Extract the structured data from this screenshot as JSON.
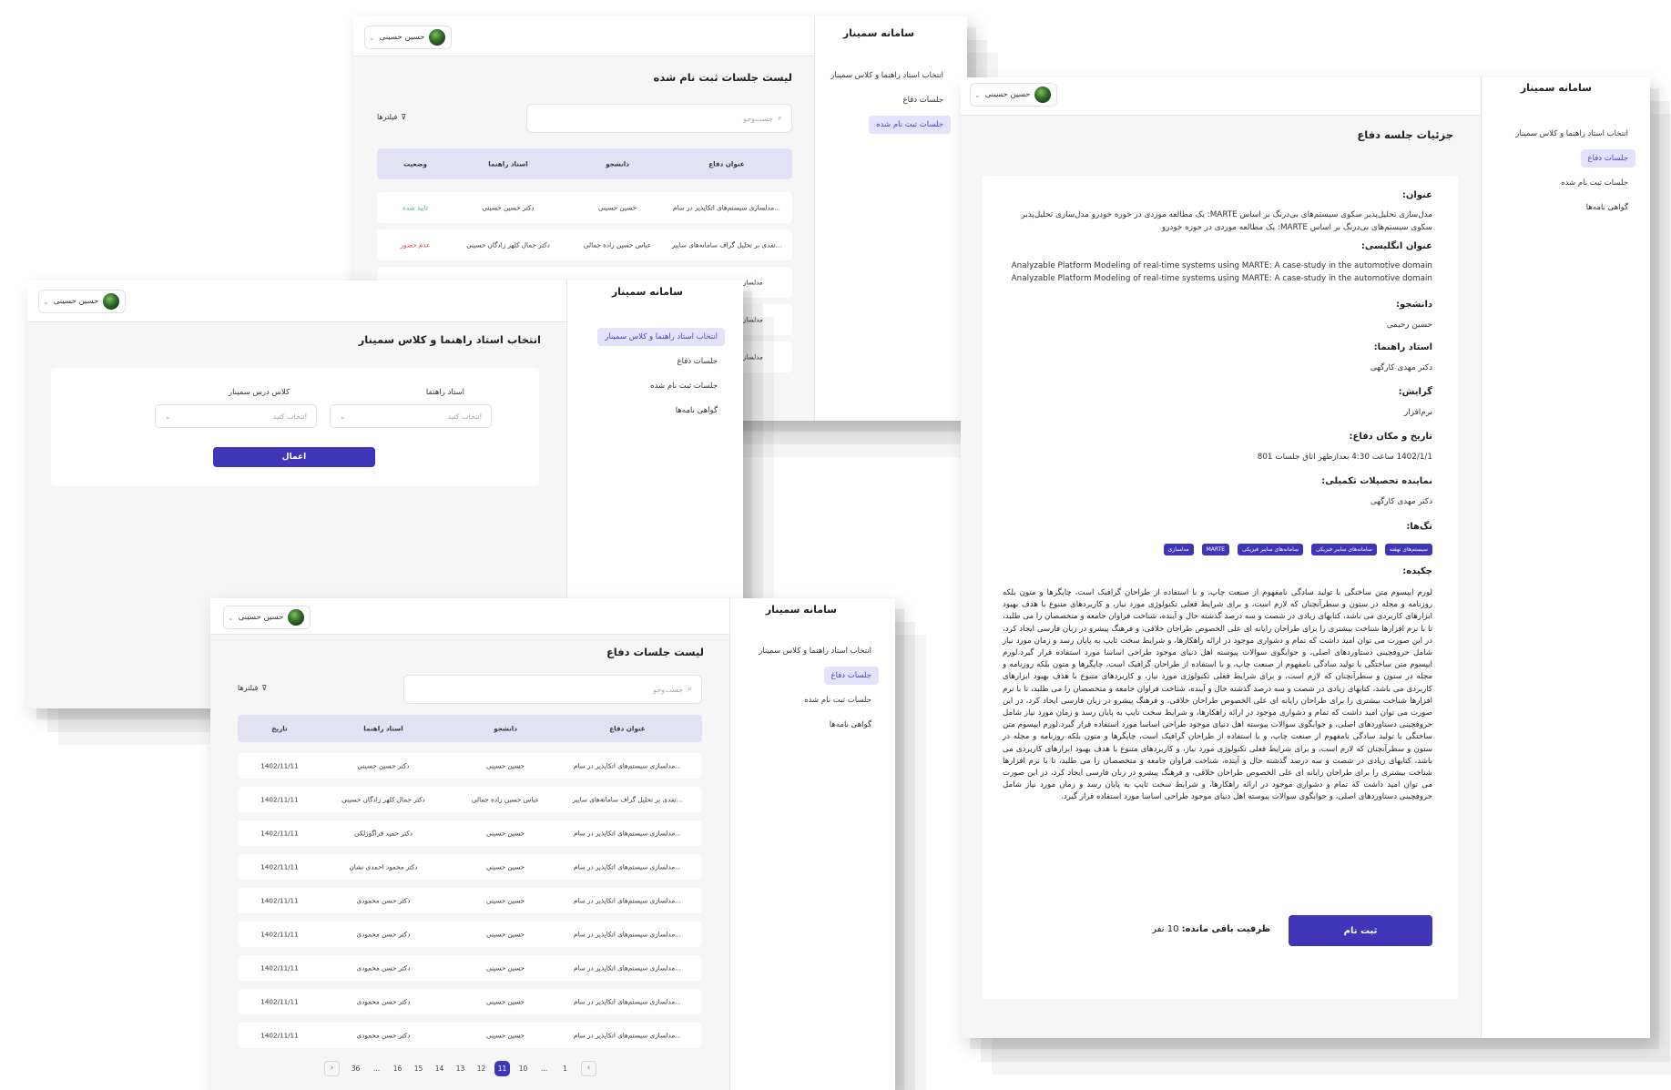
{
  "common": {
    "brand": "سامانه سمینار",
    "user_name": "حسین حسینی",
    "search_placeholder": "جست‌وجو",
    "filters_label": "فیلترها",
    "select_placeholder": "انتخاب کنید"
  },
  "nav": {
    "choose": "انتخاب استاد راهنما و کلاس سمینار",
    "defense": "جلسات دفاع",
    "registered": "جلسات ثبت نام شده",
    "certs": "گواهی نامه‌ها"
  },
  "registered_win": {
    "title": "لیست جلسات ثبت نام شده",
    "headers": [
      "عنوان دفاع",
      "دانشجو",
      "استاد راهنما",
      "وضعیت"
    ],
    "rows": [
      [
        "مدلسازی سیستم‌های اتکاپذیر در سام...",
        "حسین حسینی",
        "دکتر حسین حسینی",
        "تایید شده"
      ],
      [
        "نقدی بر تحلیل گراف سامانه‌های سایبر...",
        "عباس حسین زاده جمالی",
        "دکتر جمال کلهر زادگان حسینی",
        "عدم حضور"
      ],
      [
        "مدلسازی",
        "",
        "",
        ""
      ],
      [
        "مدلسازی",
        "",
        "",
        ""
      ],
      [
        "مدلسازی",
        "",
        "",
        ""
      ]
    ]
  },
  "choose_win": {
    "title": "انتخاب استاد راهنما و کلاس سمینار",
    "advisor_label": "استاد راهنما",
    "class_label": "کلاس درس سمینار",
    "apply": "اعمال"
  },
  "defense_win": {
    "title": "لیست جلسات دفاع",
    "headers": [
      "عنوان دفاع",
      "دانشجو",
      "استاد راهنما",
      "تاریخ"
    ],
    "rows": [
      [
        "مدلسازی سیستم‌های اتکاپذیر در سام...",
        "حسین حسینی",
        "دکتر حسین حسینی",
        "1402/11/11"
      ],
      [
        "نقدی بر تحلیل گراف سامانه‌های سایبر...",
        "عباس حسین زاده جمالی",
        "دکتر جمال کلهر زادگان حسینی",
        "1402/11/11"
      ],
      [
        "مدلسازی سیستم‌های اتکاپذیر در سام...",
        "حسین حسینی",
        "دکتر حمید قراگوزلکی",
        "1402/11/11"
      ],
      [
        "مدلسازی سیستم‌های اتکاپذیر در سام...",
        "حسین حسینی",
        "دکتر محمود احمدی نشان",
        "1402/11/11"
      ],
      [
        "مدلسازی سیستم‌های اتکاپذیر در سام...",
        "حسین حسینی",
        "دکتر حسن محمودی",
        "1402/11/11"
      ],
      [
        "مدلسازی سیستم‌های اتکاپذیر در سام...",
        "حسین حسینی",
        "دکتر حسن محمودی",
        "1402/11/11"
      ],
      [
        "مدلسازی سیستم‌های اتکاپذیر در سام...",
        "حسین حسینی",
        "دکتر حسن محمودی",
        "1402/11/11"
      ],
      [
        "مدلسازی سیستم‌های اتکاپذیر در سام...",
        "حسین حسینی",
        "دکتر حسن محمودی",
        "1402/11/11"
      ],
      [
        "مدلسازی سیستم‌های اتکاپذیر در سام...",
        "حسین حسینی",
        "دکتر حسن محمودی",
        "1402/11/11"
      ]
    ],
    "pager": {
      "prev": "›",
      "next": "‹",
      "pages": [
        "1",
        "...",
        "10",
        "11",
        "12",
        "13",
        "14",
        "15",
        "16",
        "...",
        "36"
      ],
      "current": "11"
    }
  },
  "detail_win": {
    "title": "جزئیات جلسه دفاع",
    "title_label": "عنوان:",
    "title_value": "مدل‌سازی تحلیل‌پذیر سکوی سیستم‌های بی‌درنگ بر اساس MARTE: یک مطالعه موردی در حوزه خودرو مدل‌سازی تحلیل‌پذیر سکوی سیستم‌های بی‌درنگ بر اساس MARTE: یک مطالعه موردی در حوزه خودرو",
    "en_label": "عنوان انگلیسی:",
    "en_value_1": "Analyzable Platform Modeling of real-time systems using MARTE: A case-study in the automotive domain",
    "en_value_2": "Analyzable Platform Modeling of real-time systems using MARTE: A case-study in the automotive domain",
    "student_label": "دانشجو:",
    "student_value": "حسین رحیمی",
    "advisor_label": "استاد راهنما:",
    "advisor_value": "دکتر مهدی کارگهی",
    "field_label": "گرایش:",
    "field_value": "نرم‌افزار",
    "datetime_label": "تاریخ و مکان دفاع:",
    "datetime_value": "1402/1/1 ساعت 4:30 بعدازظهر اتاق جلسات 801",
    "rep_label": "نماینده تحصیلات تکمیلی:",
    "rep_value": "دکتر مهدی کارگهی",
    "tags_label": "تگ‌ها:",
    "tags": [
      "سیستم‌های نهفته",
      "سامانه‌های سایبر فیزیکی",
      "سامانه‌های سایبر فیزیکی",
      "MARTE",
      "مدلسازی"
    ],
    "abstract_label": "چکیده:",
    "abstract": "لورم ایپسوم متن ساختگی با تولید سادگی نامفهوم از صنعت چاپ، و با استفاده از طراحان گرافیک است، چاپگرها و متون بلکه روزنامه و مجله در ستون و سطرآنچنان که لازم است، و برای شرایط فعلی تکنولوژی مورد نیاز، و کاربردهای متنوع با هدف بهبود ابزارهای کاربردی می باشد، کتابهای زیادی در شصت و سه درصد گذشته حال و آینده، شناخت فراوان جامعه و متخصصان را می طلبد، تا با نرم افزارها شناخت بیشتری را برای طراحان رایانه ای علی الخصوص طراحان خلاقی، و فرهنگ پیشرو در زبان فارسی ایجاد کرد، در این صورت می توان امید داشت که تمام و دشواری موجود در ارائه راهکارها، و شرایط سخت تایپ به پایان رسد و زمان مورد نیاز شامل حروفچینی دستاوردهای اصلی، و جوابگوی سوالات پیوسته اهل دنیای موجود طراحی اساسا مورد استفاده قرار گیرد.لورم ایپسوم متن ساختگی با تولید سادگی نامفهوم از صنعت چاپ، و با استفاده از طراحان گرافیک است، چاپگرها و متون بلکه روزنامه و مجله در ستون و سطرآنچنان که لازم است، و برای شرایط فعلی تکنولوژی مورد نیاز، و کاربردهای متنوع با هدف بهبود ابزارهای کاربردی می باشد، کتابهای زیادی در شصت و سه درصد گذشته حال و آینده، شناخت فراوان جامعه و متخصصان را می طلبد، تا با نرم افزارها شناخت بیشتری را برای طراحان رایانه ای علی الخصوص طراحان خلاقی، و فرهنگ پیشرو در زبان فارسی ایجاد کرد، در این صورت می توان امید داشت که تمام و دشواری موجود در ارائه راهکارها، و شرایط سخت تایپ به پایان رسد و زمان مورد نیاز شامل حروفچینی دستاوردهای اصلی، و جوابگوی سوالات پیوسته اهل دنیای موجود طراحی اساسا مورد استفاده قرار گیرد.لورم ایپسوم متن ساختگی با تولید سادگی نامفهوم از صنعت چاپ، و با استفاده از طراحان گرافیک است، چاپگرها و متون بلکه روزنامه و مجله در ستون و سطرآنچنان که لازم است، و برای شرایط فعلی تکنولوژی مورد نیاز، و کاربردهای متنوع با هدف بهبود ابزارهای کاربردی می باشد، کتابهای زیادی در شصت و سه درصد گذشته حال و آینده، شناخت فراوان جامعه و متخصصان را می طلبد، تا با نرم افزارها شناخت بیشتری را برای طراحان رایانه ای علی الخصوص طراحان خلاقی، و فرهنگ پیشرو در زبان فارسی ایجاد کرد، در این صورت می توان امید داشت که تمام و دشواری موجود در ارائه راهکارها، و شرایط سخت تایپ به پایان رسد و زمان مورد نیاز شامل حروفچینی دستاوردهای اصلی، و جوابگوی سوالات پیوسته اهل دنیای موجود طراحی اساسا مورد استفاده قرار گیرد.",
    "register": "ثبت نام",
    "capacity_label": "ظرفیت باقی مانده:",
    "capacity_value": "10 نفر"
  },
  "colors": {
    "primary": "#3e35b8",
    "nav_active_bg": "#e5e3fb",
    "table_header": "#e2e2f4",
    "status_ok": "#3fb37f",
    "status_bad": "#e04545"
  }
}
